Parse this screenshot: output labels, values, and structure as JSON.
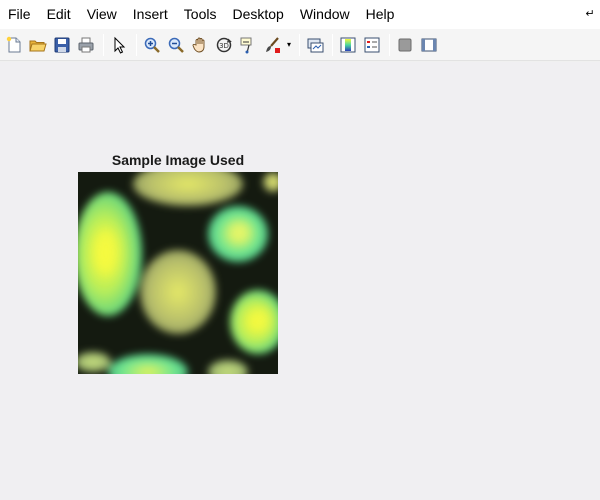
{
  "menubar": {
    "items": [
      "File",
      "Edit",
      "View",
      "Insert",
      "Tools",
      "Desktop",
      "Window",
      "Help"
    ],
    "dock_icon": "dock-arrow-icon"
  },
  "toolbar": {
    "buttons": [
      "new-figure-icon",
      "open-file-icon",
      "save-figure-icon",
      "print-figure-icon",
      "edit-plot-icon",
      "zoom-in-icon",
      "zoom-out-icon",
      "pan-icon",
      "rotate-3d-icon",
      "data-cursor-icon",
      "brush-icon",
      "link-plot-icon",
      "insert-colorbar-icon",
      "insert-legend-icon",
      "hide-plot-tools-icon",
      "show-plot-tools-icon"
    ]
  },
  "figure": {
    "axes_title": "Sample Image Used",
    "colors": {
      "background": "#f0eff2",
      "blob_yellow": "#f4f83a",
      "blob_green": "#5fe08f",
      "blob_olive": "#c8cf6a",
      "dark": "#141a10"
    }
  }
}
